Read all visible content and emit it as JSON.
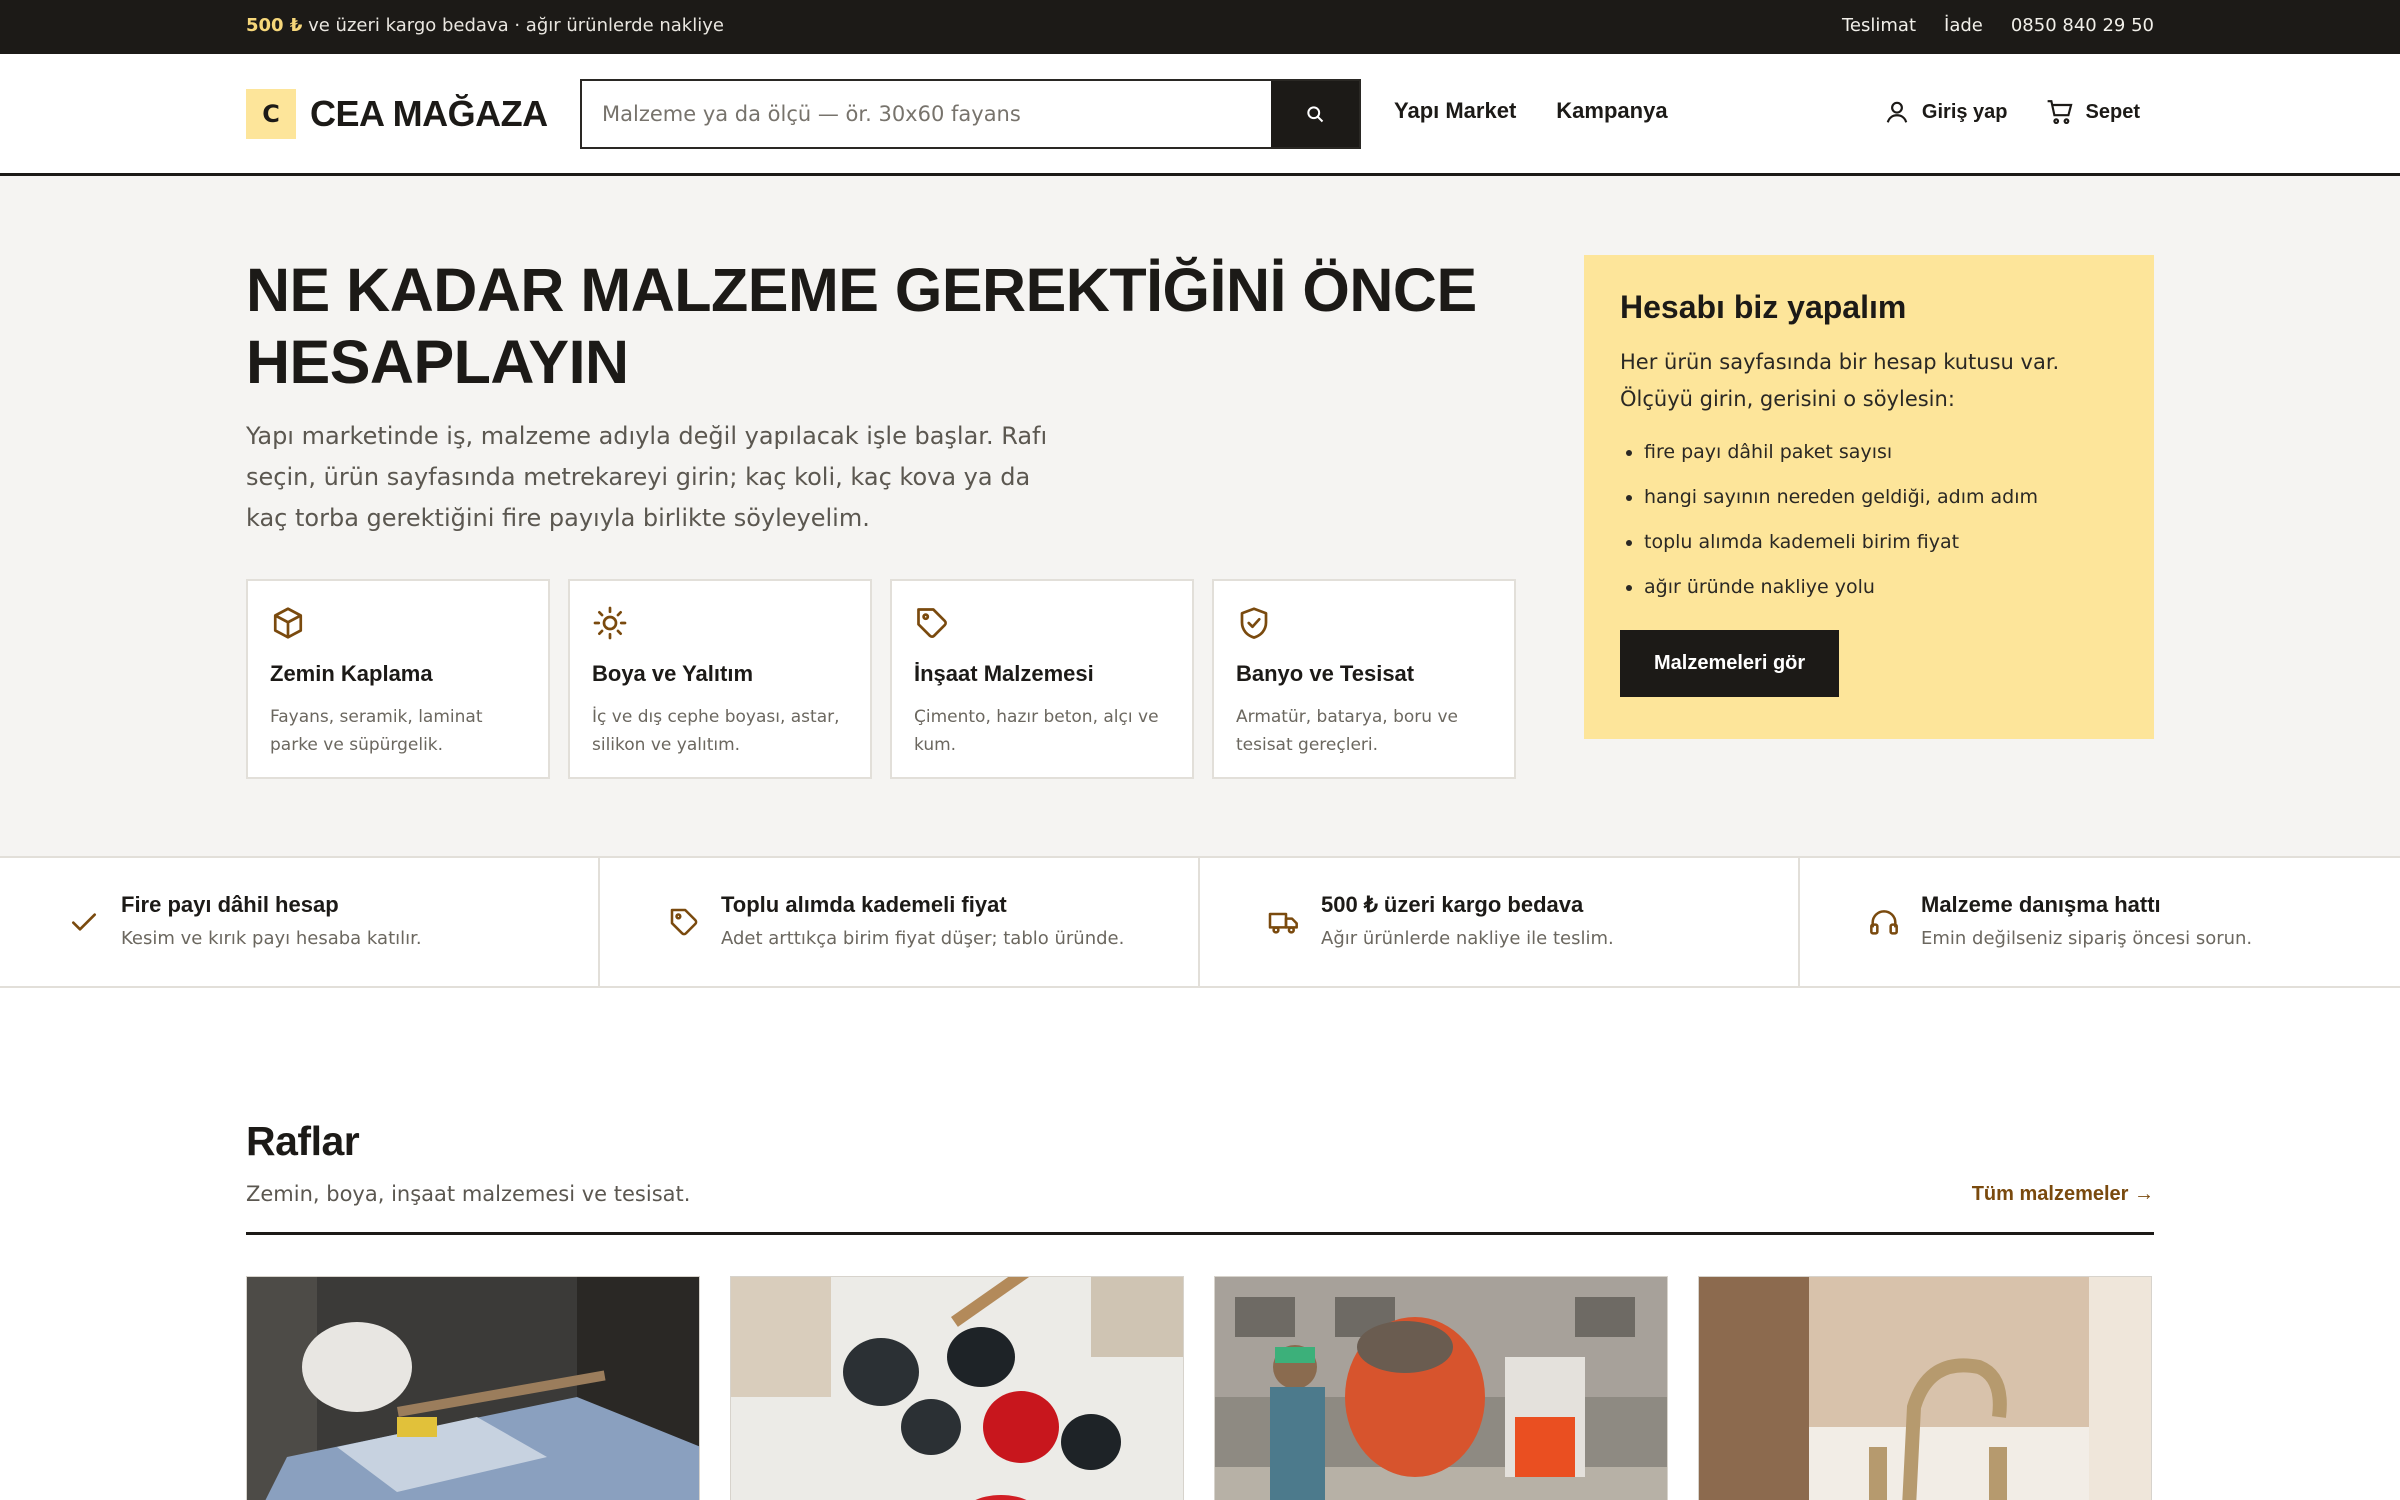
{
  "topbar": {
    "promo_strong": "500 ₺",
    "promo_rest": " ve üzeri kargo bedava · ağır ürünlerde nakliye",
    "links": [
      "Teslimat",
      "İade",
      "0850 840 29 50"
    ]
  },
  "header": {
    "logo_mark": "C",
    "logo_name": "CEA MAĞAZA",
    "search_placeholder": "Malzeme ya da ölçü — ör. 30x60 fayans",
    "nav": [
      "Yapı Market",
      "Kampanya"
    ],
    "login": "Giriş yap",
    "cart": "Sepet"
  },
  "hero": {
    "title": "NE KADAR MALZEME GEREKTİĞİNİ ÖNCE HESAPLAYIN",
    "lead": "Yapı marketinde iş, malzeme adıyla değil yapılacak işle başlar. Rafı seçin, ürün sayfasında metrekareyi girin; kaç koli, kaç kova ya da kaç torba gerektiğini fire payıyla birlikte söyleyelim.",
    "categories": [
      {
        "title": "Zemin Kaplama",
        "desc": "Fayans, seramik, laminat parke ve süpürgelik.",
        "icon": "box-icon"
      },
      {
        "title": "Boya ve Yalıtım",
        "desc": "İç ve dış cephe boyası, astar, silikon ve yalıtım.",
        "icon": "sun-icon"
      },
      {
        "title": "İnşaat Malzemesi",
        "desc": "Çimento, hazır beton, alçı ve kum.",
        "icon": "tag-icon"
      },
      {
        "title": "Banyo ve Tesisat",
        "desc": "Armatür, batarya, boru ve tesisat gereçleri.",
        "icon": "shield-check-icon"
      }
    ],
    "calc": {
      "title": "Hesabı biz yapalım",
      "text": "Her ürün sayfasında bir hesap kutusu var. Ölçüyü girin, gerisini o söylesin:",
      "bullets": [
        "fire payı dâhil paket sayısı",
        "hangi sayının nereden geldiği, adım adım",
        "toplu alımda kademeli birim fiyat",
        "ağır üründe nakliye yolu"
      ],
      "cta": "Malzemeleri gör"
    }
  },
  "features": [
    {
      "title": "Fire payı dâhil hesap",
      "desc": "Kesim ve kırık payı hesaba katılır.",
      "icon": "check-icon"
    },
    {
      "title": "Toplu alımda kademeli fiyat",
      "desc": "Adet arttıkça birim fiyat düşer; tablo üründe.",
      "icon": "tag-icon"
    },
    {
      "title": "500 ₺ üzeri kargo bedava",
      "desc": "Ağır ürünlerde nakliye ile teslim.",
      "icon": "truck-icon"
    },
    {
      "title": "Malzeme danışma hattı",
      "desc": "Emin değilseniz sipariş öncesi sorun.",
      "icon": "headphones-icon"
    }
  ],
  "shelves": {
    "title": "Raflar",
    "subtitle": "Zemin, boya, inşaat malzemesi ve tesisat.",
    "all_link": "Tüm malzemeler →"
  },
  "colors": {
    "dark": "#1c1a17",
    "accent_yellow": "#fde59a",
    "accent_brown": "#7a4a0e",
    "hero_bg": "#f5f4f2"
  }
}
